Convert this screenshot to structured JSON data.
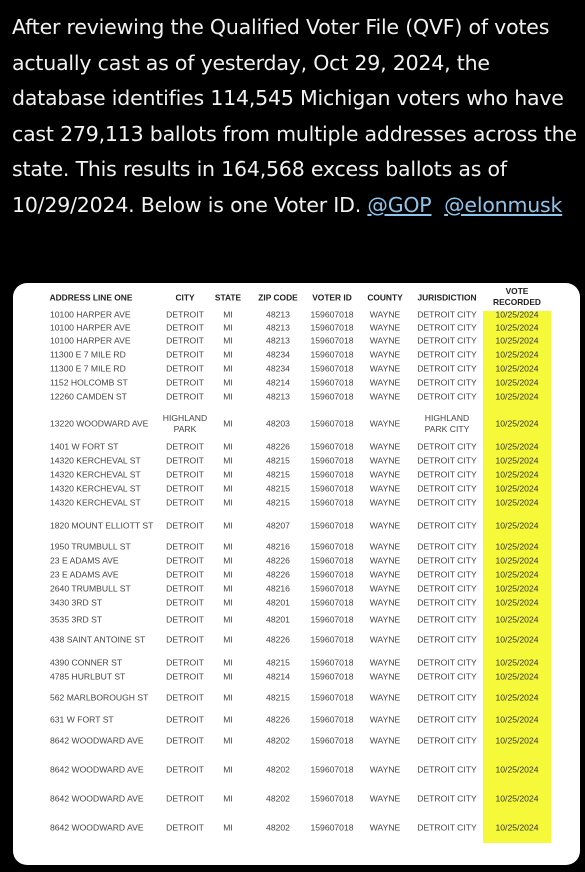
{
  "post": {
    "text": "After reviewing the Qualified Voter File (QVF) of votes actually cast as of yesterday, Oct 29, 2024, the database identifies 114,545 Michigan voters who have cast 279,113 ballots from multiple addresses across the state. This results in 164,568 excess ballots as of 10/29/2024. Below is one Voter ID.",
    "mentions": [
      "@GOP",
      "@elonmusk"
    ]
  },
  "highlight_color": "#f6f83a",
  "table": {
    "headers": [
      "ADDRESS LINE ONE",
      "CITY",
      "STATE",
      "ZIP CODE",
      "VOTER ID",
      "COUNTY",
      "JURISDICTION",
      "VOTE RECORDED"
    ],
    "rows": [
      [
        "10100 HARPER AVE",
        "DETROIT",
        "MI",
        "48213",
        "159607018",
        "WAYNE",
        "DETROIT CITY",
        "10/25/2024"
      ],
      [
        "10100 HARPER AVE",
        "DETROIT",
        "MI",
        "48213",
        "159607018",
        "WAYNE",
        "DETROIT CITY",
        "10/25/2024"
      ],
      [
        "10100 HARPER AVE",
        "DETROIT",
        "MI",
        "48213",
        "159607018",
        "WAYNE",
        "DETROIT CITY",
        "10/25/2024"
      ],
      [
        "11300 E 7 MILE RD",
        "DETROIT",
        "MI",
        "48234",
        "159607018",
        "WAYNE",
        "DETROIT CITY",
        "10/25/2024"
      ],
      [
        "11300 E 7 MILE RD",
        "DETROIT",
        "MI",
        "48234",
        "159607018",
        "WAYNE",
        "DETROIT CITY",
        "10/25/2024"
      ],
      [
        "1152 HOLCOMB ST",
        "DETROIT",
        "MI",
        "48214",
        "159607018",
        "WAYNE",
        "DETROIT CITY",
        "10/25/2024"
      ],
      [
        "12260 CAMDEN ST",
        "DETROIT",
        "MI",
        "48213",
        "159607018",
        "WAYNE",
        "DETROIT CITY",
        "10/25/2024"
      ],
      [
        "13220 WOODWARD AVE",
        "HIGHLAND PARK",
        "MI",
        "48203",
        "159607018",
        "WAYNE",
        "HIGHLAND PARK CITY",
        "10/25/2024"
      ],
      [
        "1401 W FORT ST",
        "DETROIT",
        "MI",
        "48226",
        "159607018",
        "WAYNE",
        "DETROIT CITY",
        "10/25/2024"
      ],
      [
        "14320 KERCHEVAL ST",
        "DETROIT",
        "MI",
        "48215",
        "159607018",
        "WAYNE",
        "DETROIT CITY",
        "10/25/2024"
      ],
      [
        "14320 KERCHEVAL ST",
        "DETROIT",
        "MI",
        "48215",
        "159607018",
        "WAYNE",
        "DETROIT CITY",
        "10/25/2024"
      ],
      [
        "14320 KERCHEVAL ST",
        "DETROIT",
        "MI",
        "48215",
        "159607018",
        "WAYNE",
        "DETROIT CITY",
        "10/25/2024"
      ],
      [
        "14320 KERCHEVAL ST",
        "DETROIT",
        "MI",
        "48215",
        "159607018",
        "WAYNE",
        "DETROIT CITY",
        "10/25/2024"
      ],
      [
        "1820 MOUNT ELLIOTT ST",
        "DETROIT",
        "MI",
        "48207",
        "159607018",
        "WAYNE",
        "DETROIT CITY",
        "10/25/2024"
      ],
      [
        "1950 TRUMBULL ST",
        "DETROIT",
        "MI",
        "48216",
        "159607018",
        "WAYNE",
        "DETROIT CITY",
        "10/25/2024"
      ],
      [
        "23 E ADAMS AVE",
        "DETROIT",
        "MI",
        "48226",
        "159607018",
        "WAYNE",
        "DETROIT CITY",
        "10/25/2024"
      ],
      [
        "23 E ADAMS AVE",
        "DETROIT",
        "MI",
        "48226",
        "159607018",
        "WAYNE",
        "DETROIT CITY",
        "10/25/2024"
      ],
      [
        "2640 TRUMBULL ST",
        "DETROIT",
        "MI",
        "48216",
        "159607018",
        "WAYNE",
        "DETROIT CITY",
        "10/25/2024"
      ],
      [
        "3430 3RD ST",
        "DETROIT",
        "MI",
        "48201",
        "159607018",
        "WAYNE",
        "DETROIT CITY",
        "10/25/2024"
      ],
      [
        "3535 3RD ST",
        "DETROIT",
        "MI",
        "48201",
        "159607018",
        "WAYNE",
        "DETROIT CITY",
        "10/25/2024"
      ],
      [
        "438 SAINT ANTOINE ST",
        "DETROIT",
        "MI",
        "48226",
        "159607018",
        "WAYNE",
        "DETROIT CITY",
        "10/25/2024"
      ],
      [
        "4390 CONNER ST",
        "DETROIT",
        "MI",
        "48215",
        "159607018",
        "WAYNE",
        "DETROIT CITY",
        "10/25/2024"
      ],
      [
        "4785 HURLBUT ST",
        "DETROIT",
        "MI",
        "48214",
        "159607018",
        "WAYNE",
        "DETROIT CITY",
        "10/25/2024"
      ],
      [
        "562 MARLBOROUGH ST",
        "DETROIT",
        "MI",
        "48215",
        "159607018",
        "WAYNE",
        "DETROIT CITY",
        "10/25/2024"
      ],
      [
        "631 W FORT ST",
        "DETROIT",
        "MI",
        "48226",
        "159607018",
        "WAYNE",
        "DETROIT CITY",
        "10/25/2024"
      ],
      [
        "8642 WOODWARD AVE",
        "DETROIT",
        "MI",
        "48202",
        "159607018",
        "WAYNE",
        "DETROIT CITY",
        "10/25/2024"
      ],
      [
        "8642 WOODWARD AVE",
        "DETROIT",
        "MI",
        "48202",
        "159607018",
        "WAYNE",
        "DETROIT CITY",
        "10/25/2024"
      ],
      [
        "8642 WOODWARD AVE",
        "DETROIT",
        "MI",
        "48202",
        "159607018",
        "WAYNE",
        "DETROIT CITY",
        "10/25/2024"
      ],
      [
        "8642 WOODWARD AVE",
        "DETROIT",
        "MI",
        "48202",
        "159607018",
        "WAYNE",
        "DETROIT CITY",
        "10/25/2024"
      ]
    ]
  }
}
